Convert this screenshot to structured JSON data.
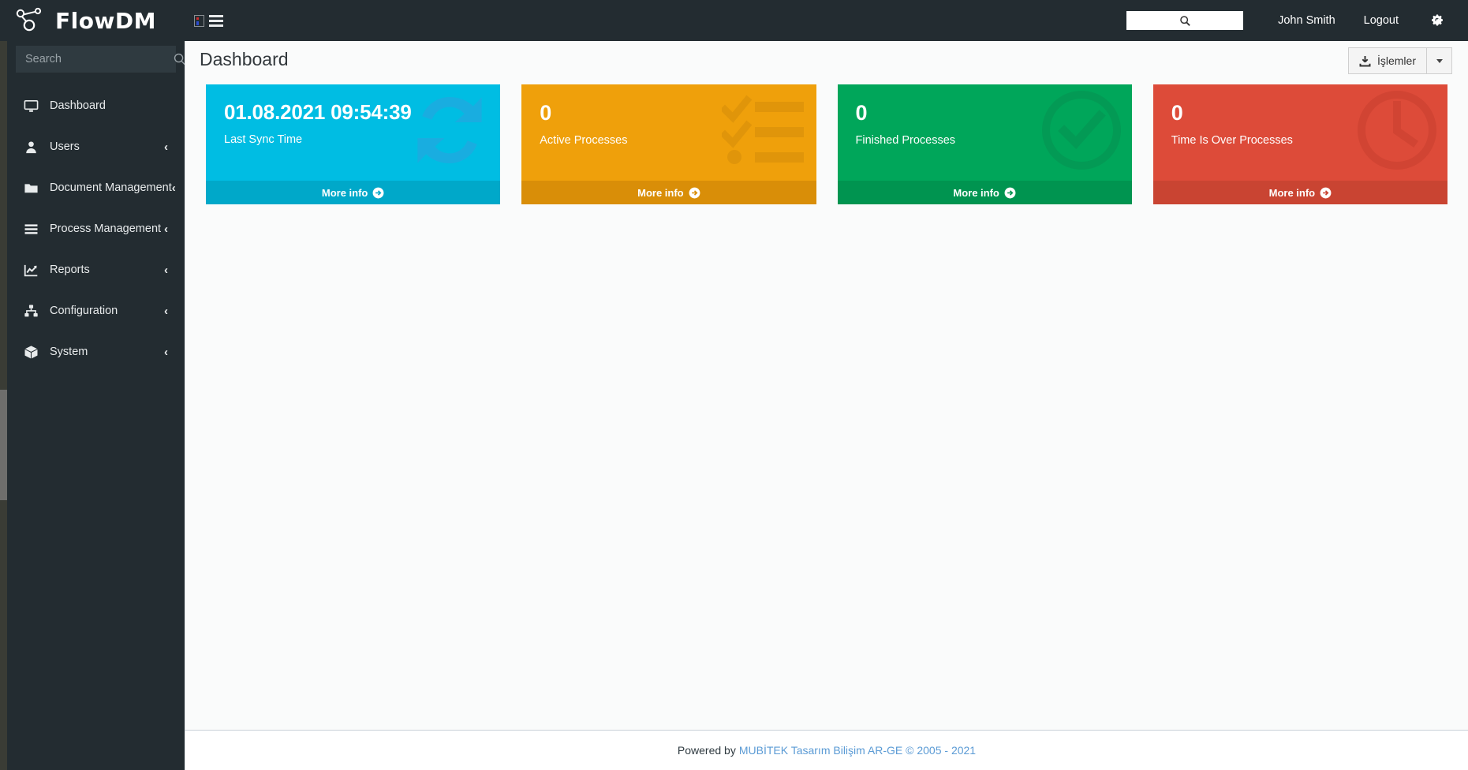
{
  "brand": {
    "name": "FlowDM",
    "logo_icon": "network-nodes-icon"
  },
  "header": {
    "image_placeholder_icon": "broken-image-icon",
    "menu_toggle_icon": "hamburger-icon",
    "search": {
      "value": "",
      "placeholder": "",
      "icon": "search-icon"
    },
    "user_name": "John Smith",
    "logout_label": "Logout",
    "settings_icon": "cogs-icon"
  },
  "sidebar": {
    "search": {
      "value": "",
      "placeholder": "Search",
      "icon": "search-icon"
    },
    "items": [
      {
        "label": "Dashboard",
        "icon": "desktop-icon",
        "caret": "‹",
        "has_caret": false,
        "active": true
      },
      {
        "label": "Users",
        "icon": "user-icon",
        "caret": "‹",
        "has_caret": true,
        "active": false
      },
      {
        "label": "Document Management",
        "icon": "folder-icon",
        "caret": "‹",
        "has_caret": true,
        "active": false
      },
      {
        "label": "Process Management",
        "icon": "list-bars-icon",
        "caret": "‹",
        "has_caret": true,
        "active": false
      },
      {
        "label": "Reports",
        "icon": "chart-line-icon",
        "caret": "‹",
        "has_caret": true,
        "active": false
      },
      {
        "label": "Configuration",
        "icon": "sitemap-icon",
        "caret": "‹",
        "has_caret": true,
        "active": false
      },
      {
        "label": "System",
        "icon": "cube-icon",
        "caret": "‹",
        "has_caret": true,
        "active": false
      }
    ]
  },
  "page": {
    "title": "Dashboard",
    "actions_button": {
      "label": "İşlemler",
      "icon": "download-icon"
    },
    "actions_caret_icon": "chevron-down-icon"
  },
  "cards": [
    {
      "value": "01.08.2021 09:54:39",
      "label": "Last Sync Time",
      "more_label": "More info",
      "more_icon": "arrow-circle-right-icon",
      "bg_icon": "sync-refresh-icon",
      "color": "#00bde3",
      "footer_color": "#00a8c9",
      "icon_color": "#19ade0",
      "is_timestamp": true
    },
    {
      "value": "0",
      "label": "Active Processes",
      "more_label": "More info",
      "more_icon": "arrow-circle-right-icon",
      "bg_icon": "tasks-checklist-icon",
      "color": "#efa00b",
      "footer_color": "#d98e08",
      "icon_color": "#e0950a",
      "is_timestamp": false
    },
    {
      "value": "0",
      "label": "Finished Processes",
      "more_label": "More info",
      "more_icon": "arrow-circle-right-icon",
      "bg_icon": "check-circle-icon",
      "color": "#00a65a",
      "footer_color": "#009450",
      "icon_color": "#039a55",
      "is_timestamp": false
    },
    {
      "value": "0",
      "label": "Time Is Over Processes",
      "more_label": "More info",
      "more_icon": "arrow-circle-right-icon",
      "bg_icon": "clock-icon",
      "color": "#dd4b39",
      "footer_color": "#c94432",
      "icon_color": "#d14433",
      "is_timestamp": false
    }
  ],
  "footer": {
    "powered_by": "Powered by",
    "company": "MUBİTEK Tasarım Bilişim AR-GE © 2005 - 2021"
  },
  "colors": {
    "sidebar_bg": "#232c31",
    "header_bg": "#232c31",
    "content_bg": "#fafbfb",
    "link": "#5b9bd5"
  }
}
